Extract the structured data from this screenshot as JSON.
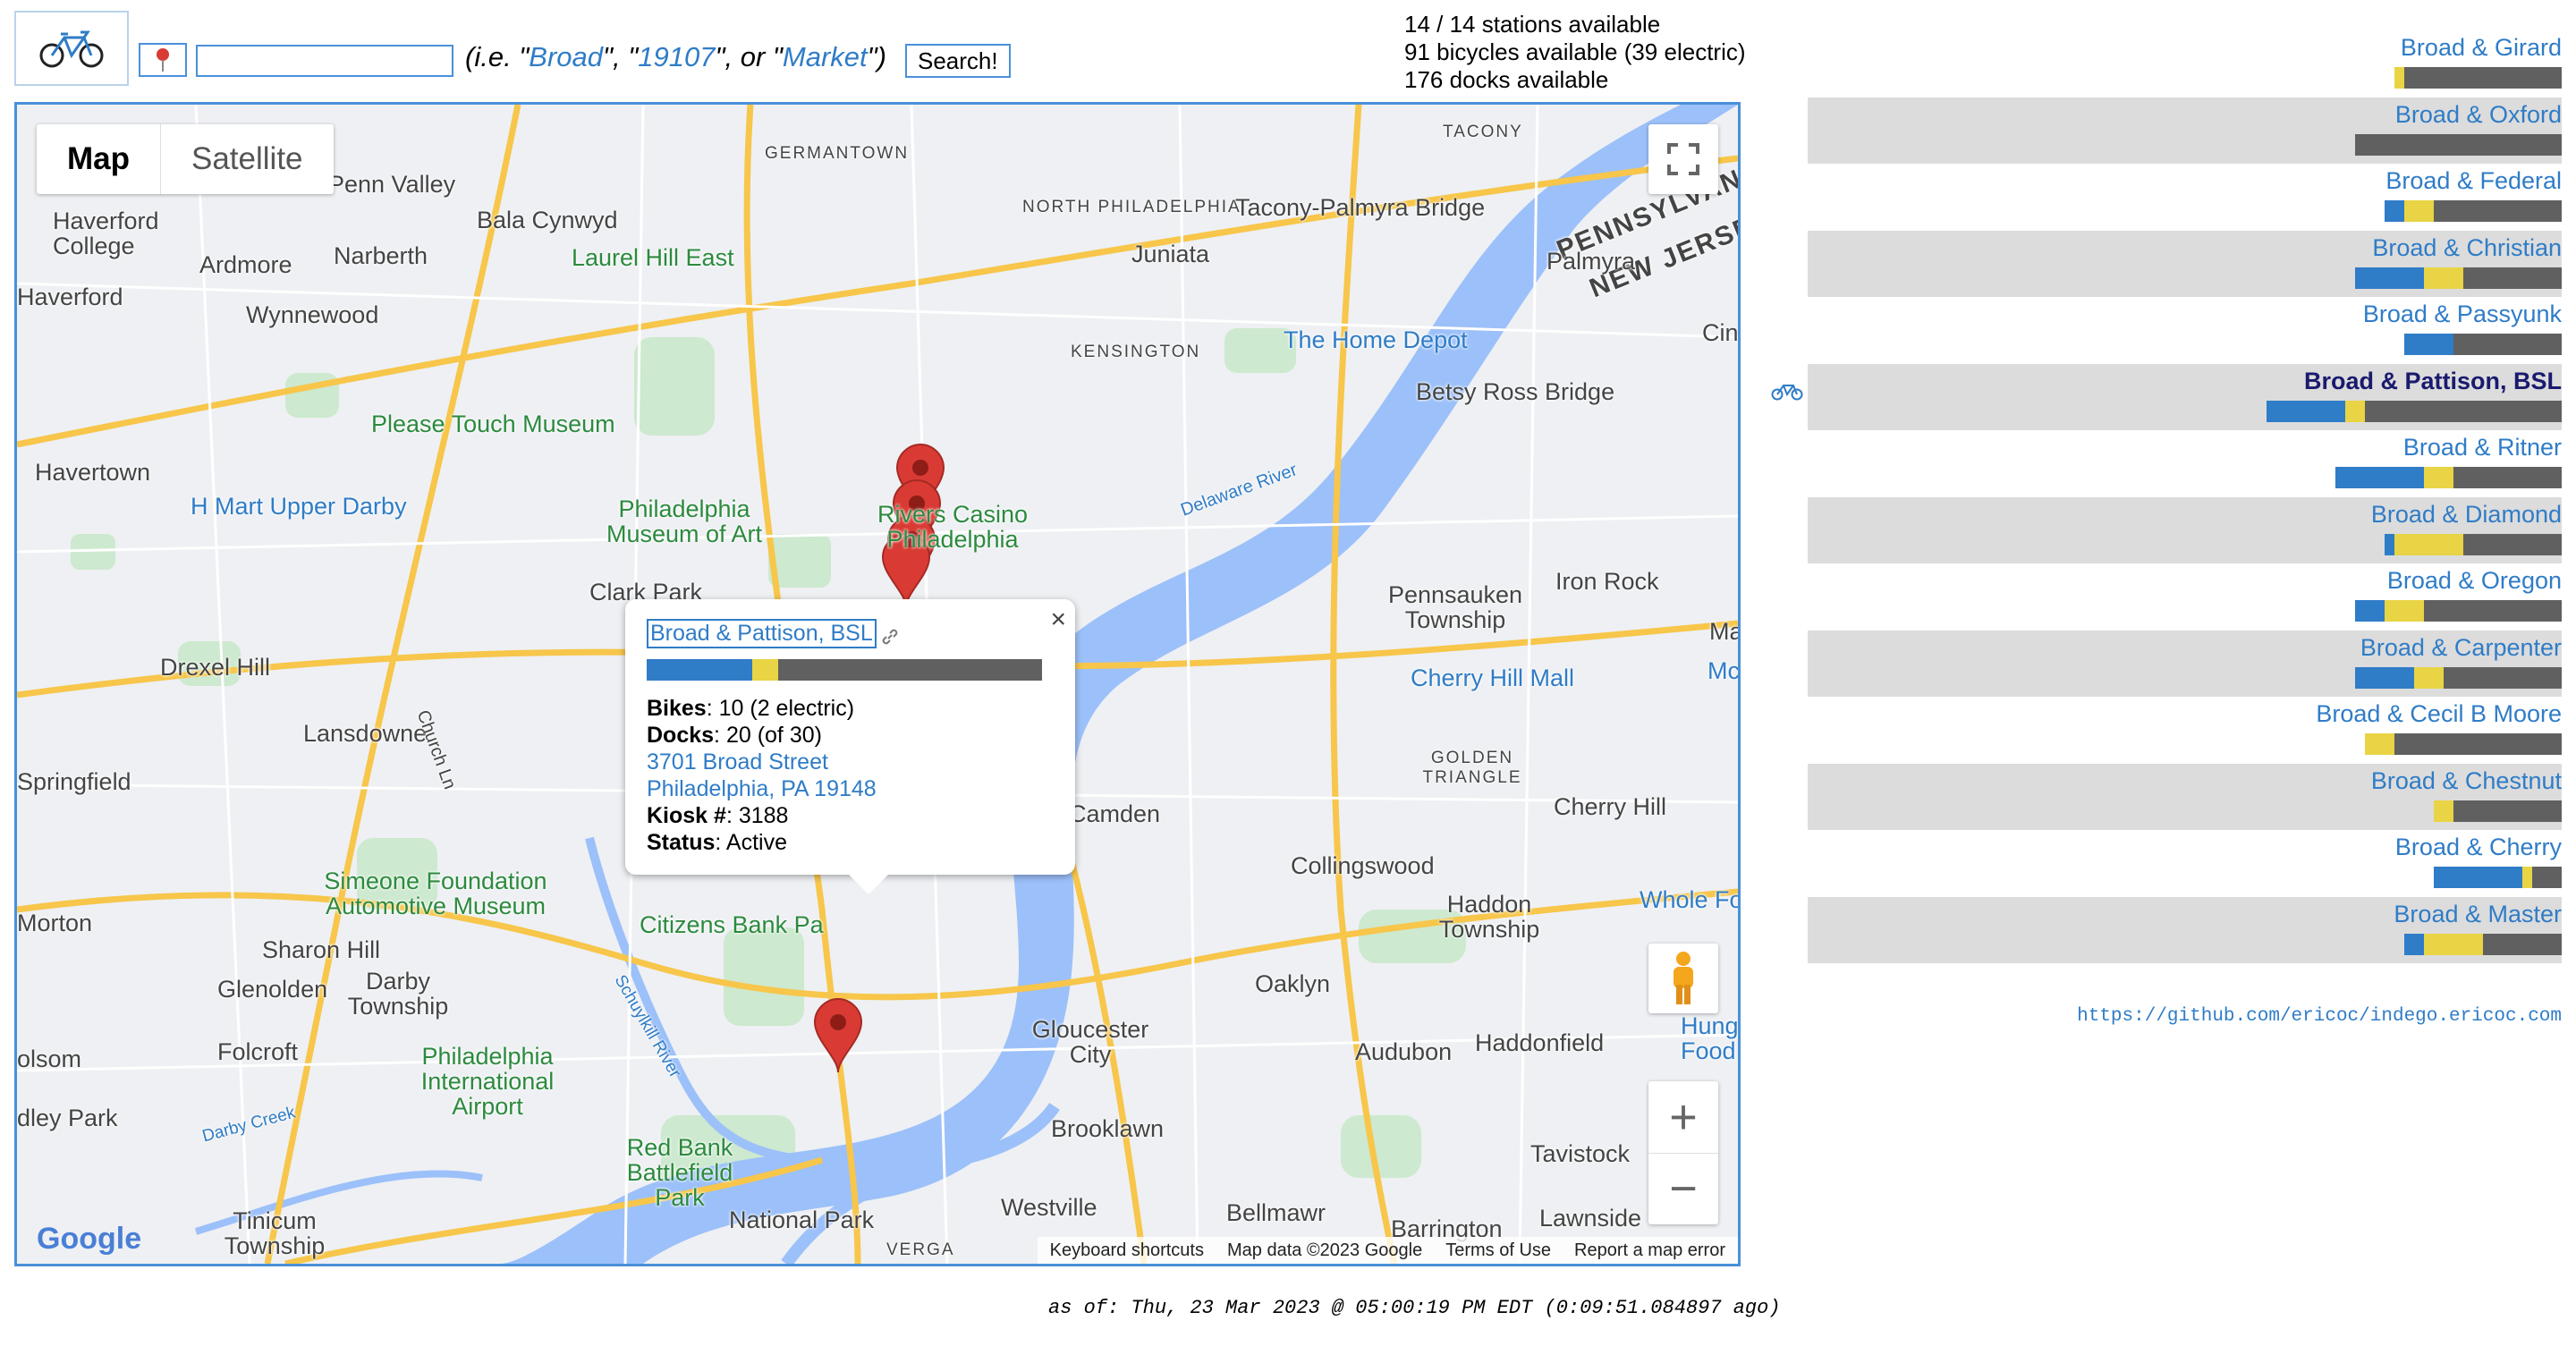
{
  "header": {
    "search_placeholder": "",
    "hint_prefix": "(i.e. \"",
    "hint_ex1": "Broad",
    "hint_sep1": "\", \"",
    "hint_ex2": "19107",
    "hint_sep2": "\", or \"",
    "hint_ex3": "Market",
    "hint_suffix": "\")",
    "search_button": "Search!"
  },
  "stats": {
    "stations": "14 / 14 stations available",
    "bicycles": "91 bicycles available (39 electric)",
    "docks": "176 docks available"
  },
  "map": {
    "map_tab": "Map",
    "satellite_tab": "Satellite",
    "google": "Google",
    "attribution": [
      "Keyboard shortcuts",
      "Map data ©2023 Google",
      "Terms of Use",
      "Report a map error"
    ],
    "labels": [
      "GERMANTOWN",
      "TACONY",
      "Penn Valley",
      "Bala Cynwyd",
      "NORTH PHILADELPHIA",
      "Tacony-Palmyra Bridge",
      "PENNSYLVANIA",
      "NEW JERSEY",
      "Haverford College",
      "Ardmore",
      "Narberth",
      "Laurel Hill East",
      "Juniata",
      "Palmyra",
      "Haverford",
      "Wynnewood",
      "KENSINGTON",
      "The Home Depot",
      "Betsy Ross Bridge",
      "Cinn",
      "Havertown",
      "Please Touch Museum",
      "H Mart Upper Darby",
      "Philadelphia Museum of Art",
      "Rivers Casino Philadelphia",
      "Delaware River",
      "Pennsauken Township",
      "Iron Rock",
      "Clark Park",
      "Drexel Hill",
      "Cherry Hill Mall",
      "Lansdowne",
      "Church Ln",
      "GOLDEN TRIANGLE",
      "Springfield",
      "Camden",
      "Cherry Hill",
      "Simeone Foundation Automotive Museum",
      "Collingswood",
      "Haddon Township",
      "Whole Fo",
      "Morton",
      "Sharon Hill",
      "Citizens Bank Pa",
      "Glenolden",
      "Darby Township",
      "Oaklyn",
      "Gloucester City",
      "Folcroft",
      "Philadelphia International Airport",
      "Schuylkill River",
      "Audubon",
      "Haddonfield",
      "Hung Food",
      "olsom",
      "dley Park",
      "Darby Creek",
      "Brooklawn",
      "Red Bank Battlefield Park",
      "Tavistock",
      "Tinicum Township",
      "National Park",
      "Westville",
      "Bellmawr",
      "Barrington",
      "Lawnside",
      "VERGA",
      "Mc",
      "Ma"
    ]
  },
  "popup": {
    "title": "Broad & Pattison, BSL",
    "bikes_label": "Bikes",
    "bikes_value": ": 10 (2 electric)",
    "docks_label": "Docks",
    "docks_value": ": 20 (of 30)",
    "address1": "3701 Broad Street",
    "address2": "Philadelphia, PA 19148",
    "kiosk_label": "Kiosk #",
    "kiosk_value": ": 3188",
    "status_label": "Status",
    "status_value": ": Active",
    "close": "×",
    "bar": {
      "classic": 8,
      "electric": 2,
      "docks": 20
    }
  },
  "stations": [
    {
      "name": "Broad & Girard",
      "classic": 0,
      "electric": 1,
      "docks": 16,
      "total": 16
    },
    {
      "name": "Broad & Oxford",
      "classic": 0,
      "electric": 0,
      "docks": 21,
      "total": 21
    },
    {
      "name": "Broad & Federal",
      "classic": 2,
      "electric": 3,
      "docks": 13,
      "total": 18
    },
    {
      "name": "Broad & Christian",
      "classic": 7,
      "electric": 4,
      "docks": 10,
      "total": 21
    },
    {
      "name": "Broad & Passyunk",
      "classic": 5,
      "electric": 0,
      "docks": 11,
      "total": 16
    },
    {
      "name": "Broad & Pattison, BSL",
      "classic": 8,
      "electric": 2,
      "docks": 20,
      "total": 30,
      "selected": true
    },
    {
      "name": "Broad & Ritner",
      "classic": 9,
      "electric": 3,
      "docks": 11,
      "total": 23
    },
    {
      "name": "Broad & Diamond",
      "classic": 1,
      "electric": 7,
      "docks": 10,
      "total": 18
    },
    {
      "name": "Broad & Oregon",
      "classic": 3,
      "electric": 4,
      "docks": 14,
      "total": 21
    },
    {
      "name": "Broad & Carpenter",
      "classic": 6,
      "electric": 3,
      "docks": 12,
      "total": 21
    },
    {
      "name": "Broad & Cecil B Moore",
      "classic": 0,
      "electric": 3,
      "docks": 17,
      "total": 20
    },
    {
      "name": "Broad & Chestnut",
      "classic": 0,
      "electric": 2,
      "docks": 11,
      "total": 13
    },
    {
      "name": "Broad & Cherry",
      "classic": 9,
      "electric": 1,
      "docks": 3,
      "total": 13
    },
    {
      "name": "Broad & Master",
      "classic": 2,
      "electric": 6,
      "docks": 8,
      "total": 16
    }
  ],
  "footer": {
    "github": "https://github.com/ericoc/indego.ericoc.com",
    "as_of": "as of: Thu, 23 Mar 2023 @ 05:00:19 PM EDT (0:09:51.084897 ago)"
  },
  "colors": {
    "classic": "#2f7cc7",
    "electric": "#e8d444",
    "docks": "#606060",
    "link": "#2f7cc7",
    "selected": "#1a1a6e"
  }
}
